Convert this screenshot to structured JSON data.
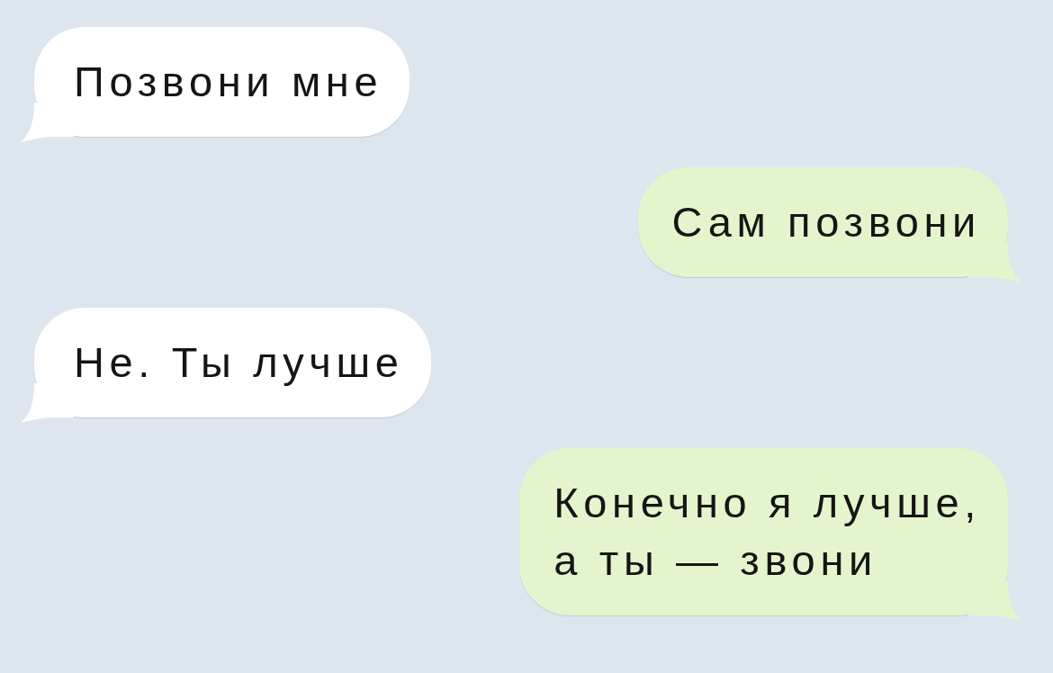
{
  "messages": [
    {
      "kind": "incoming",
      "text": "Позвони мне"
    },
    {
      "kind": "outgoing",
      "text": "Сам позвони"
    },
    {
      "kind": "incoming",
      "text": "Не. Ты лучше"
    },
    {
      "kind": "outgoing",
      "text": "Конечно я лучше,\nа ты — звони"
    }
  ]
}
